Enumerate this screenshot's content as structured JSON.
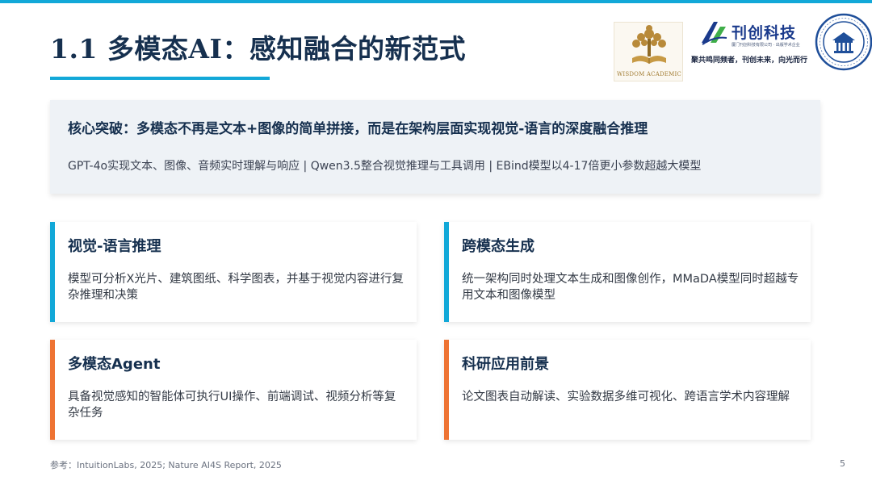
{
  "slide": {
    "title": "1.1 多模态AI：感知融合的新范式",
    "page_number": "5",
    "reference": "参考：IntuitionLabs, 2025; Nature AI4S Report, 2025"
  },
  "logos": {
    "wisdom_academic": "WISDOM ACADEMIC",
    "kanchuang_brand": "刊创科技",
    "kanchuang_sub": "厦门刊创科技有限公司 · 出版学术企业",
    "kanchuang_slogan": "聚共鸣同频者，刊创未来，向光而行"
  },
  "highlight": {
    "heading": "核心突破：多模态不再是文本+图像的简单拼接，而是在架构层面实现视觉-语言的深度融合推理",
    "detail": "GPT-4o实现文本、图像、音频实时理解与响应 | Qwen3.5整合视觉推理与工具调用 | EBind模型以4-17倍更小参数超越大模型"
  },
  "cards": [
    {
      "title": "视觉-语言推理",
      "body": "模型可分析X光片、建筑图纸、科学图表，并基于视觉内容进行复杂推理和决策",
      "accent": "#12a8d8"
    },
    {
      "title": "跨模态生成",
      "body": "统一架构同时处理文本生成和图像创作，MMaDA模型同时超越专用文本和图像模型",
      "accent": "#12a8d8"
    },
    {
      "title": "多模态Agent",
      "body": "具备视觉感知的智能体可执行UI操作、前端调试、视频分析等复杂任务",
      "accent": "#ee7333"
    },
    {
      "title": "科研应用前景",
      "body": "论文图表自动解读、实验数据多维可视化、跨语言学术内容理解",
      "accent": "#ee7333"
    }
  ],
  "colors": {
    "accent_blue": "#12a8d8",
    "accent_orange": "#ee7333",
    "title_navy": "#16304f",
    "highlight_bg": "#eef2f6"
  }
}
